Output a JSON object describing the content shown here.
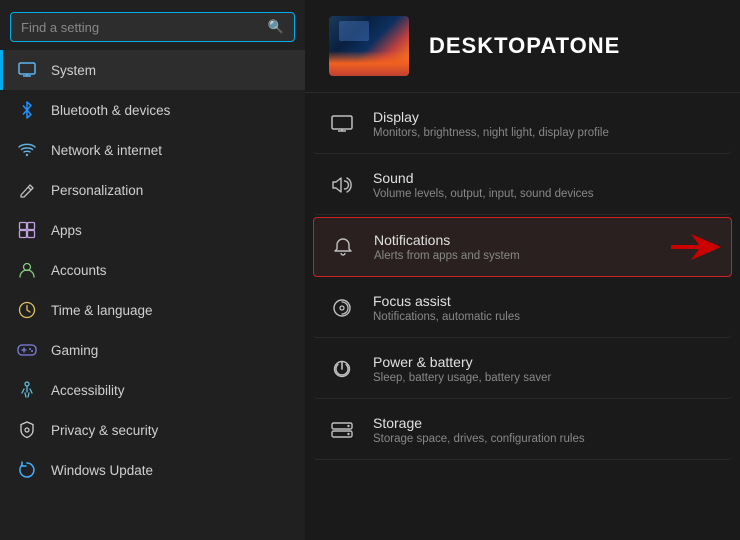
{
  "search": {
    "placeholder": "Find a setting"
  },
  "profile": {
    "name": "DESKTOPATONE"
  },
  "sidebar": {
    "items": [
      {
        "id": "system",
        "label": "System",
        "icon": "🖥",
        "active": true
      },
      {
        "id": "bluetooth",
        "label": "Bluetooth & devices",
        "icon": "🔵"
      },
      {
        "id": "network",
        "label": "Network & internet",
        "icon": "🌐"
      },
      {
        "id": "personalization",
        "label": "Personalization",
        "icon": "✏️"
      },
      {
        "id": "apps",
        "label": "Apps",
        "icon": "📦"
      },
      {
        "id": "accounts",
        "label": "Accounts",
        "icon": "👤"
      },
      {
        "id": "time",
        "label": "Time & language",
        "icon": "🕐"
      },
      {
        "id": "gaming",
        "label": "Gaming",
        "icon": "🎮"
      },
      {
        "id": "accessibility",
        "label": "Accessibility",
        "icon": "♿"
      },
      {
        "id": "privacy",
        "label": "Privacy & security",
        "icon": "🛡"
      },
      {
        "id": "windows-update",
        "label": "Windows Update",
        "icon": "🔄"
      }
    ]
  },
  "settings": {
    "items": [
      {
        "id": "display",
        "title": "Display",
        "desc": "Monitors, brightness, night light, display profile",
        "icon": "display"
      },
      {
        "id": "sound",
        "title": "Sound",
        "desc": "Volume levels, output, input, sound devices",
        "icon": "sound"
      },
      {
        "id": "notifications",
        "title": "Notifications",
        "desc": "Alerts from apps and system",
        "icon": "bell",
        "highlighted": true
      },
      {
        "id": "focus",
        "title": "Focus assist",
        "desc": "Notifications, automatic rules",
        "icon": "focus"
      },
      {
        "id": "power",
        "title": "Power & battery",
        "desc": "Sleep, battery usage, battery saver",
        "icon": "power"
      },
      {
        "id": "storage",
        "title": "Storage",
        "desc": "Storage space, drives, configuration rules",
        "icon": "storage"
      }
    ]
  }
}
